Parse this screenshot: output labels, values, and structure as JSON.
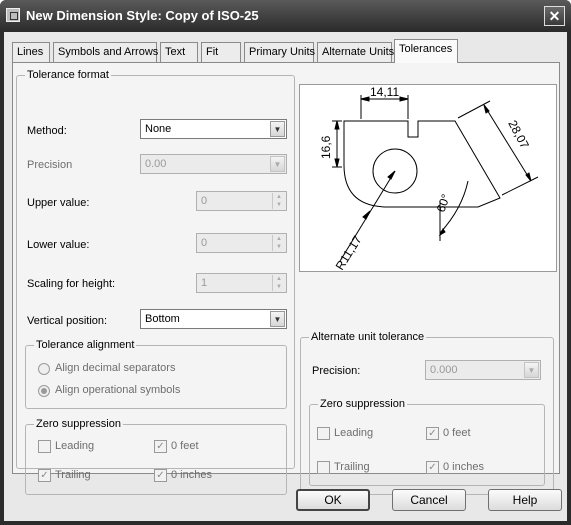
{
  "window": {
    "title": "New Dimension Style: Copy of ISO-25",
    "close_glyph": "✕"
  },
  "tabs": [
    {
      "label": "Lines"
    },
    {
      "label": "Symbols and Arrows"
    },
    {
      "label": "Text"
    },
    {
      "label": "Fit"
    },
    {
      "label": "Primary Units"
    },
    {
      "label": "Alternate Units"
    },
    {
      "label": "Tolerances",
      "active": true
    }
  ],
  "tolerance_format": {
    "title": "Tolerance format",
    "method": {
      "label": "Method:",
      "value": "None"
    },
    "precision": {
      "label": "Precision",
      "value": "0.00"
    },
    "upper_value": {
      "label": "Upper value:",
      "value": "0"
    },
    "lower_value": {
      "label": "Lower value:",
      "value": "0"
    },
    "scaling_for_height": {
      "label": "Scaling for height:",
      "value": "1"
    },
    "vertical_position": {
      "label": "Vertical position:",
      "value": "Bottom"
    }
  },
  "tolerance_alignment": {
    "title": "Tolerance alignment",
    "options": [
      {
        "label": "Align decimal separators",
        "selected": false
      },
      {
        "label": "Align operational symbols",
        "selected": true
      }
    ]
  },
  "zero_suppression_left": {
    "title": "Zero suppression",
    "leading": {
      "label": "Leading",
      "checked": false
    },
    "trailing": {
      "label": "Trailing",
      "checked": true
    },
    "zero_feet": {
      "label": "0 feet",
      "checked": true
    },
    "zero_inches": {
      "label": "0 inches",
      "checked": true
    }
  },
  "alternate_unit_tolerance": {
    "title": "Alternate unit tolerance",
    "precision": {
      "label": "Precision:",
      "value": "0.000"
    }
  },
  "zero_suppression_right": {
    "title": "Zero suppression",
    "leading": {
      "label": "Leading",
      "checked": false
    },
    "trailing": {
      "label": "Trailing",
      "checked": false
    },
    "zero_feet": {
      "label": "0 feet",
      "checked": true
    },
    "zero_inches": {
      "label": "0 inches",
      "checked": true
    }
  },
  "preview": {
    "dim_top": "14,11",
    "dim_left": "16,6",
    "dim_right": "28,07",
    "dim_angle": "60°",
    "dim_radius": "R11,17"
  },
  "buttons": {
    "ok": "OK",
    "cancel": "Cancel",
    "help": "Help"
  },
  "icons": {
    "check": "✓",
    "arrow_down": "▼",
    "spin_up": "▲",
    "spin_down": "▼"
  }
}
